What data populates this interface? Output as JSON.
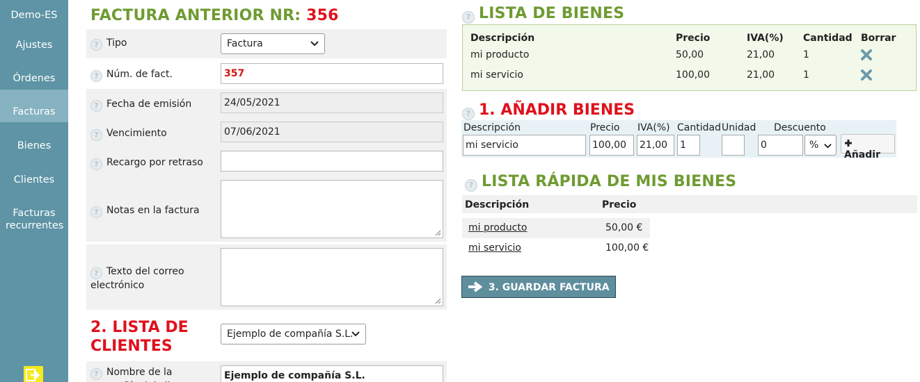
{
  "sidebar": {
    "items": [
      {
        "label": "Demo-ES"
      },
      {
        "label": "Ajustes"
      },
      {
        "label": "Órdenes"
      },
      {
        "label": "Facturas"
      },
      {
        "label": "Bienes"
      },
      {
        "label": "Clientes"
      },
      {
        "label": "Facturas recurrentes"
      }
    ],
    "active_index": 3,
    "exit_icon": "exit-icon",
    "colors": {
      "bg": "#5e94a5",
      "active": "#86b2c1"
    }
  },
  "invoice": {
    "title_prefix": "FACTURA ANTERIOR NR: ",
    "previous_number": "356",
    "help_icon_glyph": "?",
    "fields": {
      "tipo": {
        "label": "Tipo",
        "value": "Factura"
      },
      "numero": {
        "label": "Núm. de fact.",
        "value": "357"
      },
      "fecha": {
        "label": "Fecha de emisión",
        "value": "24/05/2021"
      },
      "vencimiento": {
        "label": "Vencimiento",
        "value": "07/06/2021"
      },
      "recargo": {
        "label": "Recargo por retraso",
        "value": ""
      },
      "notas": {
        "label": "Notas en la factura",
        "value": ""
      },
      "correo": {
        "label": "Texto del correo electrónico",
        "value": ""
      }
    }
  },
  "clients": {
    "title": "2. LISTA DE CLIENTES",
    "selected": "Ejemplo de compañía S.L.",
    "company_label": "Nombre de la compañía del cliente",
    "company_value": "Ejemplo de compañía S.L."
  },
  "goods_list": {
    "title": "LISTA DE BIENES",
    "headers": [
      "Descripción",
      "Precio",
      "IVA(%)",
      "Cantidad",
      "Borrar"
    ],
    "rows": [
      {
        "desc": "mi producto",
        "price": "50,00",
        "vat": "21,00",
        "qty": "1"
      },
      {
        "desc": "mi servicio",
        "price": "100,00",
        "vat": "21,00",
        "qty": "1"
      }
    ],
    "delete_icon": "close-icon"
  },
  "add_goods": {
    "title": "1. AÑADIR BIENES",
    "labels": {
      "desc": "Descripción",
      "price": "Precio",
      "vat": "IVA(%)",
      "qty": "Cantidad",
      "unit": "Unidad",
      "discount": "Descuento"
    },
    "values": {
      "desc": "mi servicio",
      "price": "100,00",
      "vat": "21,00",
      "qty": "1",
      "unit": "",
      "discount": "0",
      "discount_type": "%"
    },
    "button": "Añadir"
  },
  "quick_list": {
    "title": "LISTA RÁPIDA DE MIS BIENES",
    "headers": [
      "Descripción",
      "Precio"
    ],
    "rows": [
      {
        "desc": "mi producto",
        "price": "50,00 €"
      },
      {
        "desc": "mi servicio",
        "price": "100,00 €"
      }
    ]
  },
  "save_button": "3. GUARDAR FACTURA",
  "colors": {
    "green": "#6f9b32",
    "red": "#e0101d",
    "save_bg": "#5f8e9d"
  }
}
